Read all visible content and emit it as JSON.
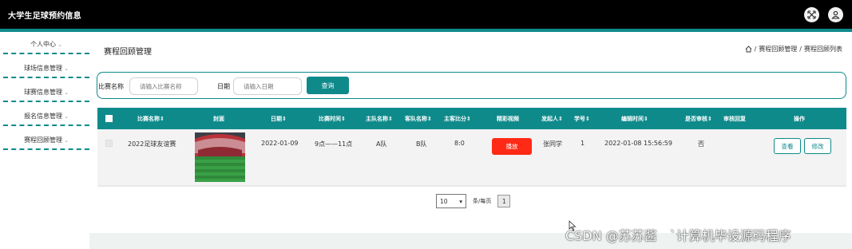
{
  "app": {
    "title": "大学生足球预约信息",
    "accent_color": "#0f8a8b",
    "icons": [
      "fullscreen-icon",
      "user-icon"
    ]
  },
  "sidebar": {
    "items": [
      {
        "label": "个人中心"
      },
      {
        "label": "球场信息管理"
      },
      {
        "label": "球赛信息管理"
      },
      {
        "label": "报名信息管理"
      },
      {
        "label": "赛程回顾管理"
      }
    ],
    "caret": "⌄"
  },
  "page": {
    "title": "赛程回顾管理",
    "breadcrumb": [
      "赛程回顾管理",
      "赛程回顾列表"
    ],
    "crumb_sep": "/"
  },
  "search": {
    "name_label": "比赛名称",
    "name_placeholder": "请输入比赛名称",
    "date_label": "日期",
    "date_placeholder": "请输入日期",
    "button": "查询"
  },
  "table": {
    "columns": [
      "比赛名称⇕",
      "封面",
      "日期⇕",
      "比赛时间⇕",
      "主队名称⇕",
      "客队名称⇕",
      "主客比分⇕",
      "精彩视频",
      "发起人⇕",
      "学号⇕",
      "编辑时间⇕",
      "是否审核⇕",
      "审核回复",
      "操作"
    ],
    "rows": [
      {
        "name": "2022足球友谊赛",
        "date": "2022-01-09",
        "time": "9点——11点",
        "home": "A队",
        "away": "B队",
        "score": "8:0",
        "video_button": "播放",
        "sponsor": "张同学",
        "student_id": "1",
        "edit_time": "2022-01-08 15:56:59",
        "reviewed": "否",
        "reply": "",
        "view_button": "查看",
        "edit_button": "修改"
      }
    ]
  },
  "pagination": {
    "page_size": "10",
    "page_size_label": "条/每页",
    "current_page": "1"
  },
  "watermark": "CSDN @苏苏酱　`计算机毕设源码程序"
}
